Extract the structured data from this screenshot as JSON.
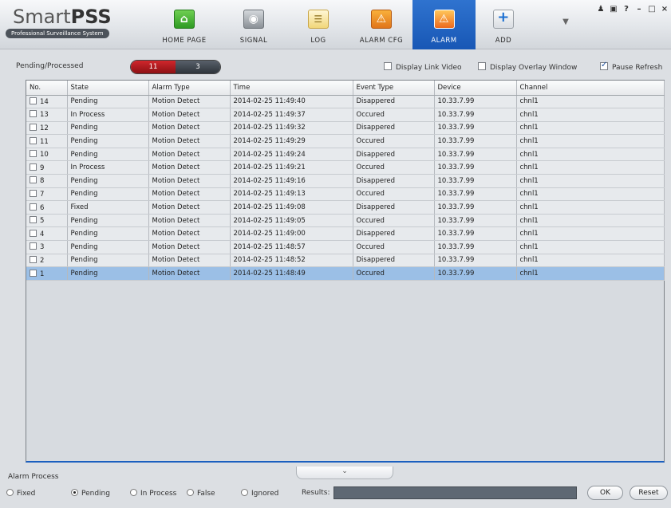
{
  "app": {
    "logo_main": "Smart",
    "logo_bold": "PSS",
    "logo_sub": "Professional Surveillance System"
  },
  "nav": [
    {
      "label": "HOME PAGE",
      "icon": "home-icon"
    },
    {
      "label": "SIGNAL",
      "icon": "signal-icon"
    },
    {
      "label": "LOG",
      "icon": "log-icon"
    },
    {
      "label": "ALARM CFG",
      "icon": "alarm-cfg-icon"
    },
    {
      "label": "ALARM",
      "icon": "alarm-icon",
      "active": true
    },
    {
      "label": "ADD",
      "icon": "add-icon"
    }
  ],
  "filter": {
    "pending_label": "Pending/Processed",
    "pending_count": "11",
    "processed_count": "3",
    "display_link_video": "Display Link Video",
    "display_overlay_window": "Display Overlay Window",
    "pause_refresh": "Pause Refresh",
    "pause_refresh_checked": true
  },
  "table": {
    "columns": [
      "No.",
      "State",
      "Alarm Type",
      "Time",
      "Event Type",
      "Device",
      "Channel"
    ],
    "rows": [
      {
        "no": "14",
        "state": "Pending",
        "type": "Motion Detect",
        "time": "2014-02-25 11:49:40",
        "event": "Disappered",
        "device": "10.33.7.99",
        "channel": "chnl1"
      },
      {
        "no": "13",
        "state": "In Process",
        "type": "Motion Detect",
        "time": "2014-02-25 11:49:37",
        "event": "Occured",
        "device": "10.33.7.99",
        "channel": "chnl1"
      },
      {
        "no": "12",
        "state": "Pending",
        "type": "Motion Detect",
        "time": "2014-02-25 11:49:32",
        "event": "Disappered",
        "device": "10.33.7.99",
        "channel": "chnl1"
      },
      {
        "no": "11",
        "state": "Pending",
        "type": "Motion Detect",
        "time": "2014-02-25 11:49:29",
        "event": "Occured",
        "device": "10.33.7.99",
        "channel": "chnl1"
      },
      {
        "no": "10",
        "state": "Pending",
        "type": "Motion Detect",
        "time": "2014-02-25 11:49:24",
        "event": "Disappered",
        "device": "10.33.7.99",
        "channel": "chnl1"
      },
      {
        "no": "9",
        "state": "In Process",
        "type": "Motion Detect",
        "time": "2014-02-25 11:49:21",
        "event": "Occured",
        "device": "10.33.7.99",
        "channel": "chnl1"
      },
      {
        "no": "8",
        "state": "Pending",
        "type": "Motion Detect",
        "time": "2014-02-25 11:49:16",
        "event": "Disappered",
        "device": "10.33.7.99",
        "channel": "chnl1"
      },
      {
        "no": "7",
        "state": "Pending",
        "type": "Motion Detect",
        "time": "2014-02-25 11:49:13",
        "event": "Occured",
        "device": "10.33.7.99",
        "channel": "chnl1"
      },
      {
        "no": "6",
        "state": "Fixed",
        "type": "Motion Detect",
        "time": "2014-02-25 11:49:08",
        "event": "Disappered",
        "device": "10.33.7.99",
        "channel": "chnl1"
      },
      {
        "no": "5",
        "state": "Pending",
        "type": "Motion Detect",
        "time": "2014-02-25 11:49:05",
        "event": "Occured",
        "device": "10.33.7.99",
        "channel": "chnl1"
      },
      {
        "no": "4",
        "state": "Pending",
        "type": "Motion Detect",
        "time": "2014-02-25 11:49:00",
        "event": "Disappered",
        "device": "10.33.7.99",
        "channel": "chnl1"
      },
      {
        "no": "3",
        "state": "Pending",
        "type": "Motion Detect",
        "time": "2014-02-25 11:48:57",
        "event": "Occured",
        "device": "10.33.7.99",
        "channel": "chnl1"
      },
      {
        "no": "2",
        "state": "Pending",
        "type": "Motion Detect",
        "time": "2014-02-25 11:48:52",
        "event": "Disappered",
        "device": "10.33.7.99",
        "channel": "chnl1"
      },
      {
        "no": "1",
        "state": "Pending",
        "type": "Motion Detect",
        "time": "2014-02-25 11:48:49",
        "event": "Occured",
        "device": "10.33.7.99",
        "channel": "chnl1",
        "selected": true
      }
    ]
  },
  "alarm_process": {
    "title": "Alarm Process",
    "options": [
      {
        "label": "Fixed",
        "checked": false
      },
      {
        "label": "Pending",
        "checked": true
      },
      {
        "label": "In Process",
        "checked": false
      },
      {
        "label": "False",
        "checked": false
      },
      {
        "label": "Ignored",
        "checked": false
      }
    ],
    "results_label": "Results:",
    "results_value": "",
    "ok_label": "OK",
    "reset_label": "Reset"
  },
  "colors": {
    "active_nav": "#1f63c4",
    "pending_badge": "#b81c21",
    "processed_badge": "#3c434b",
    "selected_row": "#9bbfe6"
  }
}
